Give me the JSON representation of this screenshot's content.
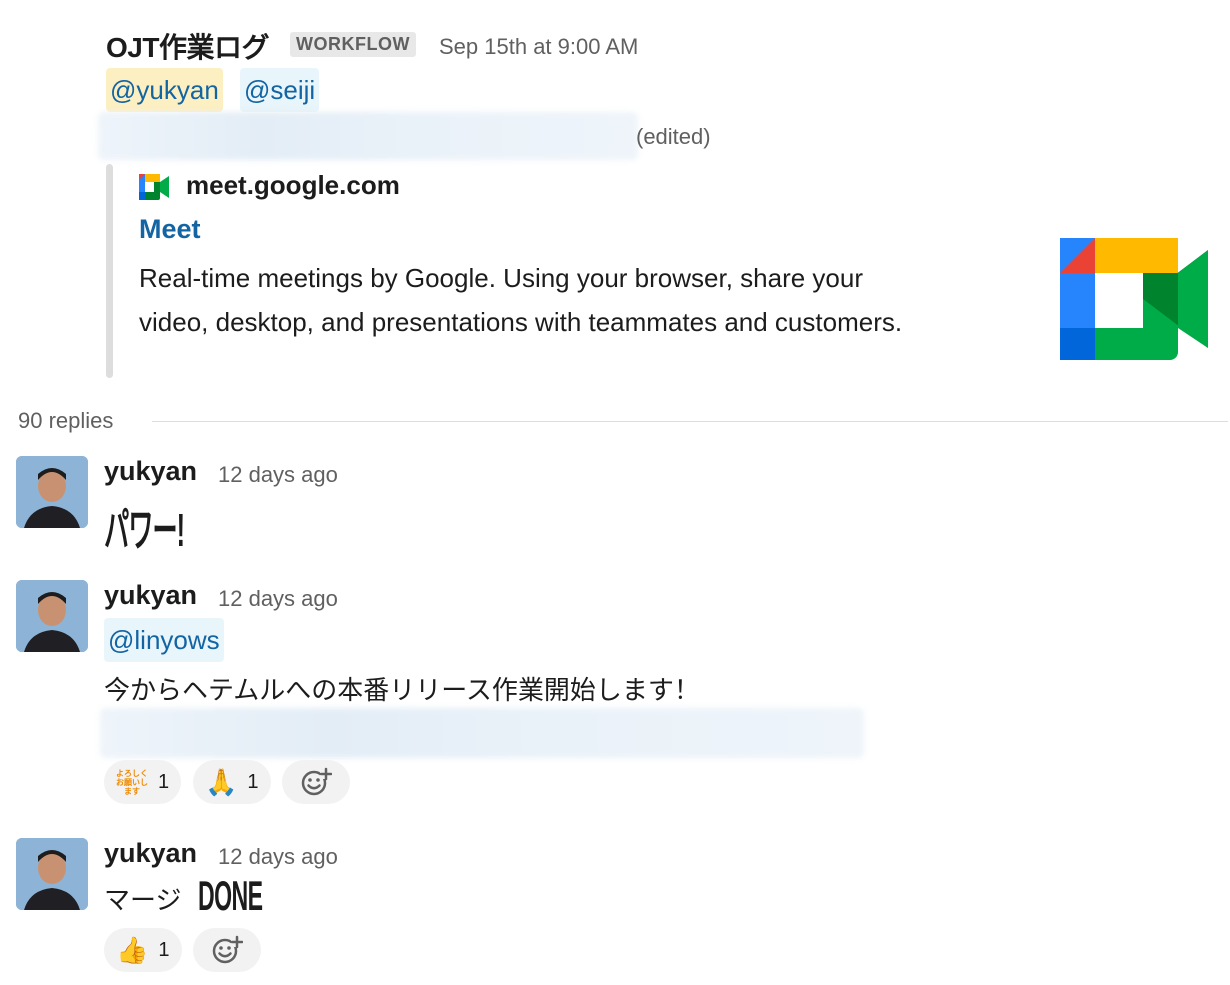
{
  "parent": {
    "author": "OJT作業ログ",
    "badge": "WORKFLOW",
    "timestamp": "Sep 15th at 9:00 AM",
    "mentions": [
      "@yukyan",
      "@seiji"
    ],
    "edited": "(edited)",
    "attachment": {
      "domain": "meet.google.com",
      "title": "Meet",
      "description_line1": "Real-time meetings by Google. Using your browser, share your",
      "description_line2": "video, desktop, and presentations with teammates and customers."
    }
  },
  "thread": {
    "replies_label": "90 replies"
  },
  "messages": [
    {
      "author": "yukyan",
      "time": "12 days ago",
      "custom_emoji": "パワー!"
    },
    {
      "author": "yukyan",
      "time": "12 days ago",
      "mention": "@linyows",
      "text": "今からヘテムルへの本番リリース作業開始します！",
      "reactions": [
        {
          "emoji": "yoroshiku-onegaishimasu",
          "label": "よろしくお願いします",
          "count": "1"
        },
        {
          "emoji": "pray",
          "glyph": "🙏",
          "count": "1"
        }
      ]
    },
    {
      "author": "yukyan",
      "time": "12 days ago",
      "text": "マージ",
      "custom_emoji": "DONE",
      "reactions": [
        {
          "emoji": "thumbsup",
          "glyph": "👍",
          "count": "1"
        }
      ]
    }
  ],
  "colors": {
    "link": "#1264a3",
    "mention_bg": "#e8f5fa",
    "self_mention_bg": "#fcefc2",
    "muted": "#616061"
  }
}
